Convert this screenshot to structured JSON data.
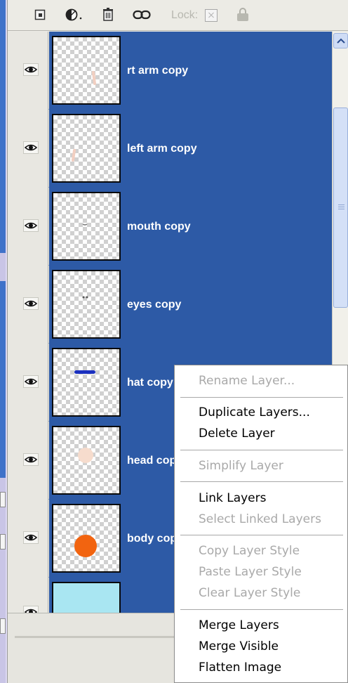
{
  "toolbar": {
    "lock_label": "Lock:",
    "icons": [
      "new-layer-icon",
      "adjustment-layer-icon",
      "trash-icon",
      "link-icon",
      "lock-transparency-icon",
      "padlock-icon"
    ]
  },
  "layers": [
    {
      "name": "rt arm copy",
      "visible": true,
      "thumb_content": "light-pink-stroke"
    },
    {
      "name": "left arm copy",
      "visible": true,
      "thumb_content": "light-pink-stroke"
    },
    {
      "name": "mouth copy",
      "visible": true,
      "thumb_content": "small-grey-mark"
    },
    {
      "name": "eyes copy",
      "visible": true,
      "thumb_content": "small-grey-dots"
    },
    {
      "name": "hat copy",
      "visible": true,
      "thumb_content": "blue-bar"
    },
    {
      "name": "head copy",
      "visible": true,
      "thumb_content": "peach-circle"
    },
    {
      "name": "body copy",
      "visible": true,
      "thumb_content": "orange-circle"
    },
    {
      "name": "",
      "visible": false,
      "thumb_content": "light-blue-fill"
    }
  ],
  "context_menu": {
    "items": [
      {
        "label": "Rename Layer...",
        "enabled": false
      },
      {
        "label": "Duplicate Layers...",
        "enabled": true
      },
      {
        "label": "Delete Layer",
        "enabled": true
      },
      {
        "label": "Simplify Layer",
        "enabled": false
      },
      {
        "label": "Link Layers",
        "enabled": true
      },
      {
        "label": "Select Linked Layers",
        "enabled": false
      },
      {
        "label": "Copy Layer Style",
        "enabled": false
      },
      {
        "label": "Paste Layer Style",
        "enabled": false
      },
      {
        "label": "Clear Layer Style",
        "enabled": false
      },
      {
        "label": "Merge Layers",
        "enabled": true
      },
      {
        "label": "Merge Visible",
        "enabled": true
      },
      {
        "label": "Flatten Image",
        "enabled": true
      }
    ]
  },
  "colors": {
    "selection": "#2d5aa6",
    "menu_disabled": "#a9a9a9",
    "panel_bg": "#ecebe5",
    "outer_bg": "#ddd9f2"
  }
}
